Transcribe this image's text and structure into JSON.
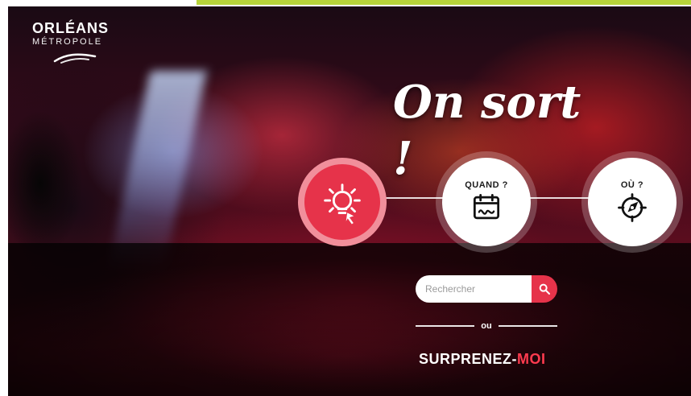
{
  "header": {
    "logo_top": "ORLÉANS",
    "logo_bottom": "MÉTROPOLE"
  },
  "headline": "On sort !",
  "options": [
    {
      "label": "",
      "icon": "lightbulb-icon"
    },
    {
      "label": "QUAND ?",
      "icon": "calendar-icon"
    },
    {
      "label": "OÙ ?",
      "icon": "compass-icon"
    }
  ],
  "search": {
    "placeholder": "Rechercher",
    "button_icon": "search-icon"
  },
  "separator_label": "ou",
  "cta": {
    "main": "SURPRENEZ-",
    "accent": "MOI"
  },
  "colors": {
    "accent": "#e6334a",
    "top_bar": "#b7d33a"
  }
}
